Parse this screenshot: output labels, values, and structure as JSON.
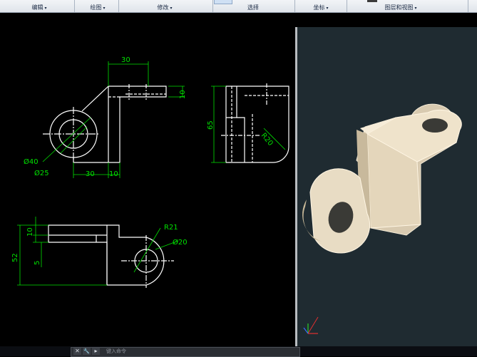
{
  "ribbon": {
    "panels": [
      {
        "label": "编辑",
        "arrow": "▾"
      },
      {
        "label": "绘图",
        "arrow": "▾"
      },
      {
        "label": "修改",
        "arrow": "▾"
      },
      {
        "label": "选择",
        "arrow": ""
      },
      {
        "label": "坐标",
        "arrow": "▾"
      },
      {
        "label": "图层和视图",
        "arrow": "▾"
      }
    ]
  },
  "drawing": {
    "dimensions": {
      "top_width": "30",
      "top_thickness": "10",
      "height_65": "65",
      "radius_20": "R20",
      "dia_40": "Ø40",
      "dia_25": "Ø25",
      "bottom_30": "30",
      "bottom_10": "10",
      "plan_10": "10",
      "plan_52": "52",
      "plan_5": "5",
      "radius_21": "R21",
      "dia_20": "Ø20"
    }
  },
  "command_line": {
    "close_glyph": "✕",
    "tool_glyph": "🔧",
    "dropdown_glyph": "▸",
    "prompt": "键入命令"
  },
  "colors": {
    "drawing_line": "#ffffff",
    "dimension": "#00e000",
    "model_face": "#e8dcc4",
    "viewport_bg": "#1f2b31"
  }
}
